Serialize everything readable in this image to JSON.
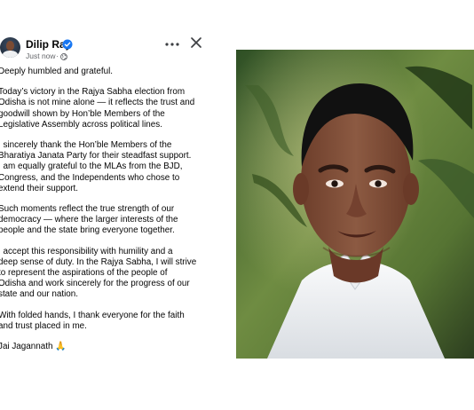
{
  "post": {
    "author": "Dilip Ray",
    "time": "Just now",
    "separator": "·",
    "icons": {
      "avatar": "profile-avatar",
      "verified": "verified-badge-icon",
      "audience": "globe-icon",
      "more": "more-options-icon",
      "close": "close-icon"
    },
    "paragraphs": [
      "Deeply humbled and grateful.",
      "Today’s victory in the Rajya Sabha election from\nOdisha is not mine alone — it reflects the trust and\ngoodwill shown by Hon’ble Members of the\nLegislative Assembly across political lines.",
      "I sincerely thank the Hon’ble Members of the\nBharatiya Janata Party for their steadfast support.\nI am equally grateful to the MLAs from the BJD,\nCongress, and the Independents who chose to\nextend their support.",
      "Such moments reflect the true strength of our\ndemocracy — where the larger interests of the\npeople and the state bring everyone together.",
      "I accept this responsibility with humility and a\ndeep sense of duty. In the Rajya Sabha, I will strive\nto represent the aspirations of the people of\nOdisha and work sincerely for the progress of our\nstate and our nation.",
      "With folded hands, I thank everyone for the faith\nand trust placed in me.",
      "Jai Jagannath 🙏"
    ]
  },
  "colors": {
    "verified": "#1877f2",
    "text": "#050505",
    "meta": "#65676b"
  }
}
